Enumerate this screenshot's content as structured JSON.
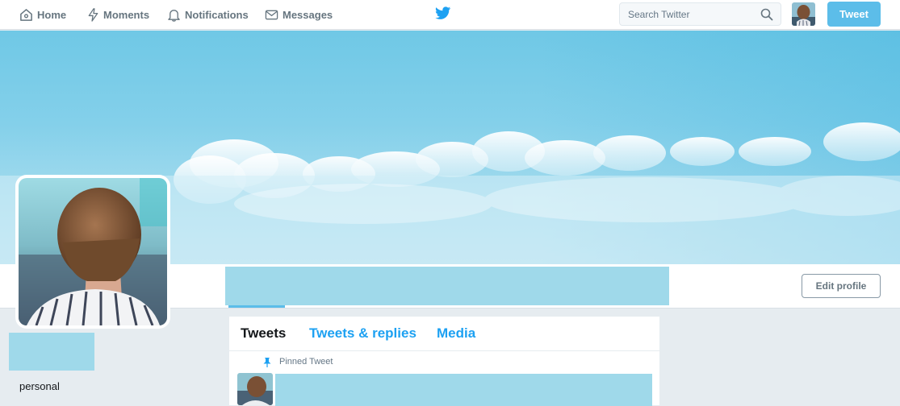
{
  "nav": {
    "home_label": "Home",
    "moments_label": "Moments",
    "notifications_label": "Notifications",
    "messages_label": "Messages",
    "logo_icon": "twitter-bird-icon",
    "search_placeholder": "Search Twitter",
    "tweet_button": "Tweet"
  },
  "profile": {
    "edit_button": "Edit profile",
    "bio": "personal"
  },
  "timeline": {
    "tabs": [
      {
        "label": "Tweets",
        "active": true
      },
      {
        "label": "Tweets & replies",
        "active": false
      },
      {
        "label": "Media",
        "active": false
      }
    ],
    "pinned_label": "Pinned Tweet"
  },
  "colors": {
    "accent": "#5cbde9",
    "link": "#1da1f2",
    "redaction": "#9fd9ea",
    "page_bg": "#e6ecf0"
  }
}
